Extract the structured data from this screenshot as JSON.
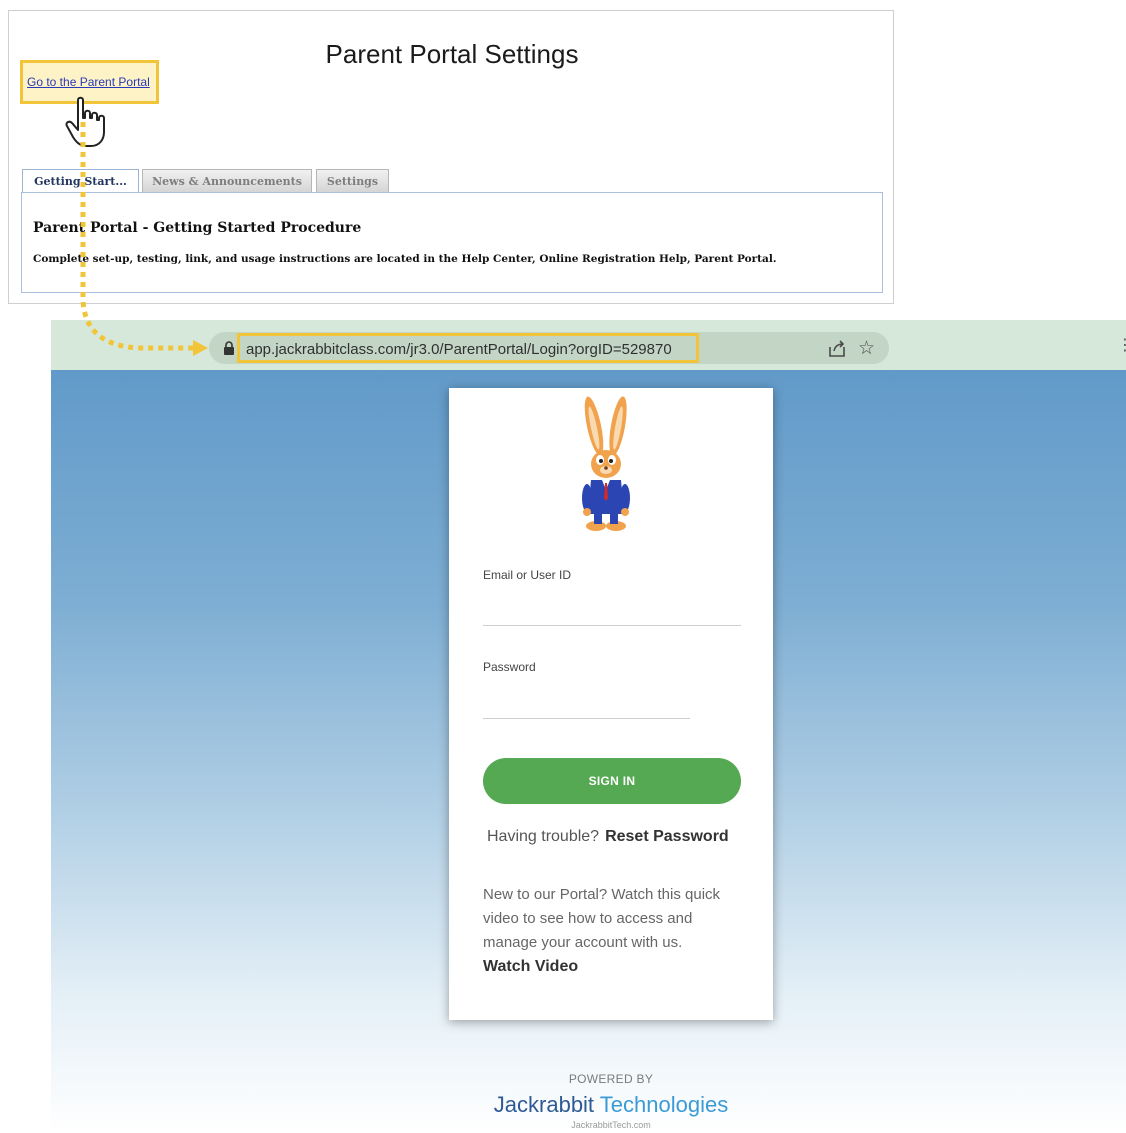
{
  "settings": {
    "title": "Parent Portal Settings",
    "portal_link": "Go to the Parent Portal",
    "tabs": [
      {
        "label": "Getting Start..."
      },
      {
        "label": "News & Announcements"
      },
      {
        "label": "Settings"
      }
    ],
    "content_heading": "Parent Portal - Getting Started Procedure",
    "content_text": "Complete set-up, testing, link, and usage instructions are located in the Help Center, Online Registration Help, Parent Portal."
  },
  "browser": {
    "url": "app.jackrabbitclass.com/jr3.0/ParentPortal/Login?orgID=529870",
    "icons": [
      "lock-icon",
      "share-icon",
      "star-icon",
      "more-icon"
    ]
  },
  "login": {
    "email_label": "Email or User ID",
    "password_label": "Password",
    "signin_label": "SIGN IN",
    "trouble_text": "Having trouble?",
    "reset_link": "Reset Password",
    "video_text": "New to our Portal? Watch this quick video to see how to access and manage your account with us.",
    "watch_link": "Watch Video"
  },
  "footer": {
    "powered_by": "POWERED BY",
    "brand_main": "Jackrabbit",
    "brand_second": " Technologies",
    "brand_url": "JackrabbitTech.com"
  },
  "colors": {
    "highlight": "#f2c43a",
    "signin_green": "#55a953",
    "brand_blue": "#2d5b96"
  }
}
